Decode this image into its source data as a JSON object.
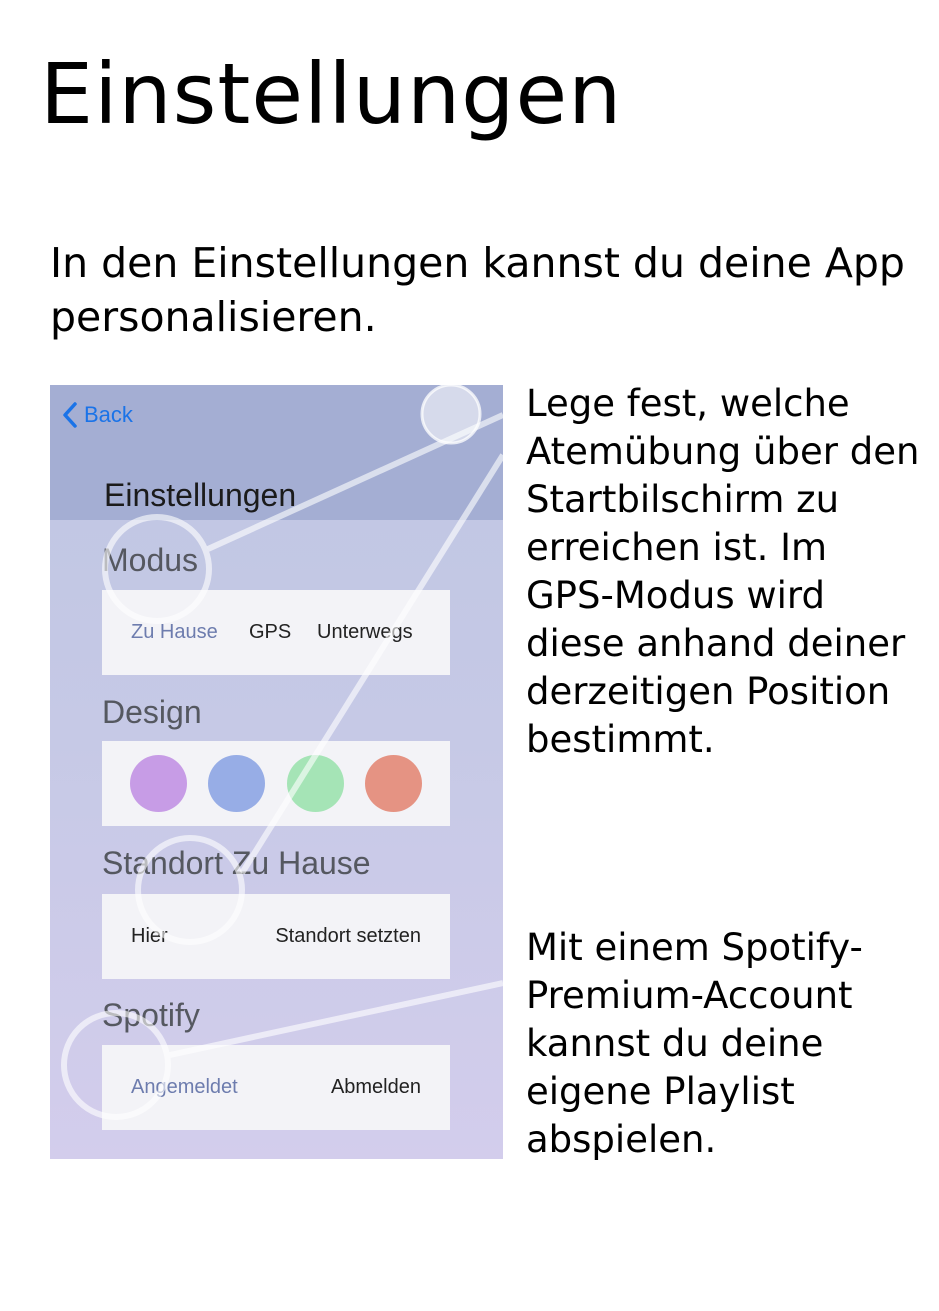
{
  "page": {
    "title": "Einstellungen",
    "intro": "In den Einstellungen kannst du deine App personalisieren."
  },
  "phone": {
    "back_label": "Back",
    "screen_title": "Einstellungen",
    "sections": {
      "modus": {
        "label": "Modus",
        "options": [
          "Zu Hause",
          "GPS",
          "Unterwegs"
        ],
        "selected": "Zu Hause"
      },
      "design": {
        "label": "Design",
        "colors": [
          "#c79ce6",
          "#97ade6",
          "#a5e4b6",
          "#e59383"
        ]
      },
      "standort": {
        "label": "Standort Zu Hause",
        "left": "Hier",
        "action": "Standort setzten"
      },
      "spotify": {
        "label": "Spotify",
        "status": "Angemeldet",
        "action": "Abmelden"
      }
    }
  },
  "annotations": {
    "modus": "Lege fest, welche Atemübung über den Startbilschirm zu erreichen ist. Im GPS-Modus wird diese anhand deiner derzeitigen Position bestimmt.",
    "spotify": "Mit einem Spotify-Premium-Account kannst du deine eigene Playlist abspielen."
  },
  "colors": {
    "nav_bar": "#a4aed3",
    "accent": "#1a73e8",
    "card": "#f3f3f7",
    "selected_option": "#6d7cae"
  }
}
